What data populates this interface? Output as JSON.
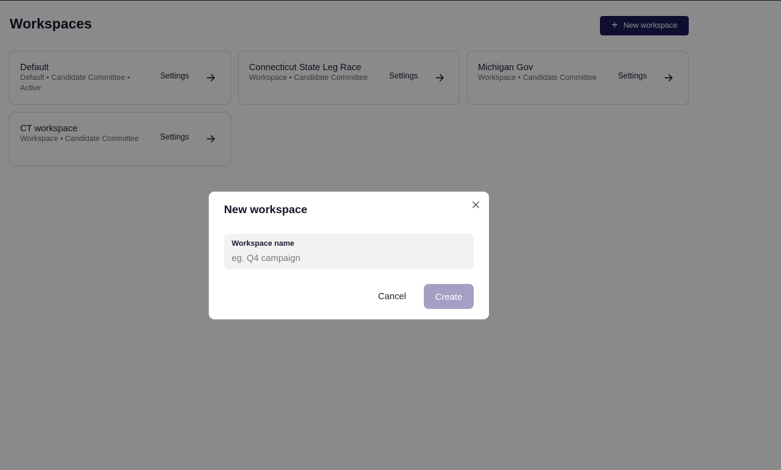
{
  "header": {
    "title": "Workspaces",
    "new_workspace_label": "New workspace",
    "plus_icon": "plus-icon"
  },
  "workspaces": [
    {
      "name": "Default",
      "meta": "Default • Candidate Committee • Active",
      "settings_label": "Settings",
      "action_icon": "arrow-right-icon"
    },
    {
      "name": "Connecticut State Leg Race",
      "meta": "Workspace • Candidate Committee",
      "settings_label": "Settings",
      "action_icon": "arrow-right-icon"
    },
    {
      "name": "Michigan Gov",
      "meta": "Workspace • Candidate Committee",
      "settings_label": "Settings",
      "action_icon": "arrow-right-icon"
    },
    {
      "name": "CT workspace",
      "meta": "Workspace • Candidate Committee",
      "settings_label": "Settings",
      "action_icon": "arrow-right-icon"
    }
  ],
  "modal": {
    "title": "New workspace",
    "close_icon": "close-icon",
    "field_label": "Workspace name",
    "field_placeholder": "eg. Q4 campaign",
    "field_value": "",
    "cancel_label": "Cancel",
    "create_label": "Create"
  },
  "colors": {
    "primary": "#1f1b5a",
    "create_disabled": "#a49fc4",
    "overlay": "rgba(0,0,0,0.46)"
  }
}
